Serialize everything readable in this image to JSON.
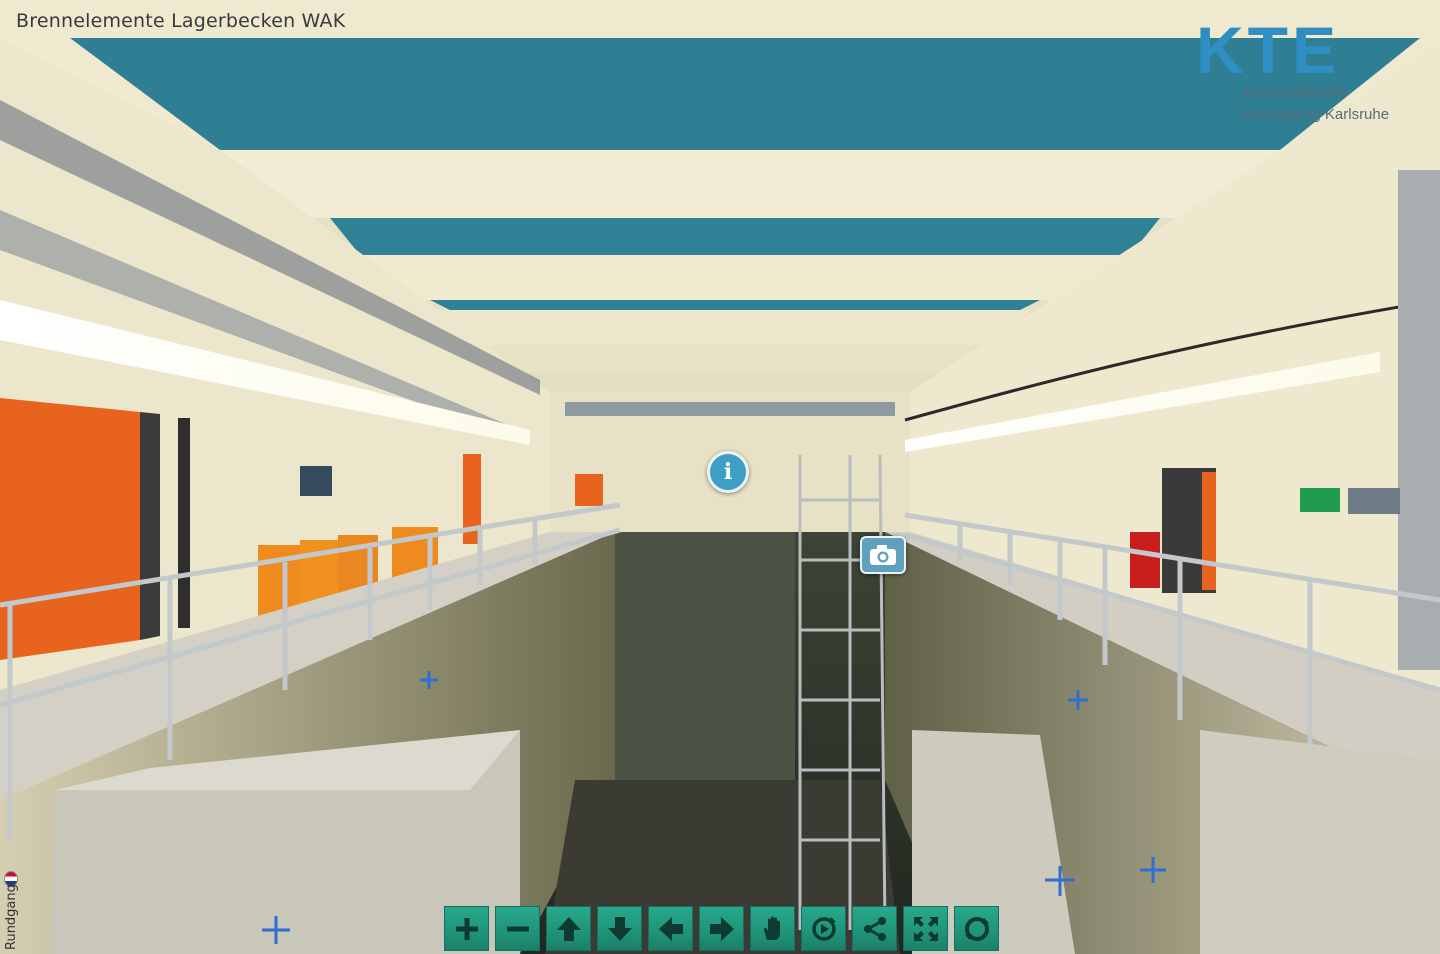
{
  "tour": {
    "title": "Brennelemente Lagerbecken WAK",
    "brand": {
      "mark": "KTE",
      "line1": "Kerntechnische",
      "line2": "Entsorgung Karlsruhe"
    },
    "side_label": "Rundgang"
  },
  "hotspots": [
    {
      "icon": "info-icon",
      "glyph": "i"
    },
    {
      "icon": "camera-icon"
    }
  ],
  "toolbar": {
    "buttons": [
      {
        "icon": "zoom-in-icon"
      },
      {
        "icon": "zoom-out-icon"
      },
      {
        "icon": "arrow-up-icon"
      },
      {
        "icon": "arrow-down-icon"
      },
      {
        "icon": "arrow-left-icon"
      },
      {
        "icon": "arrow-right-icon"
      },
      {
        "icon": "hand-icon"
      },
      {
        "icon": "autorotate-icon"
      },
      {
        "icon": "share-icon"
      },
      {
        "icon": "fullscreen-icon"
      },
      {
        "icon": "circle-icon"
      }
    ]
  },
  "colors": {
    "ceiling_panel": "#2e7f93",
    "wall": "#ece8cf",
    "door": "#e8641e",
    "toolbar_button": "#1f9378",
    "brand": "#2f8fc4"
  }
}
